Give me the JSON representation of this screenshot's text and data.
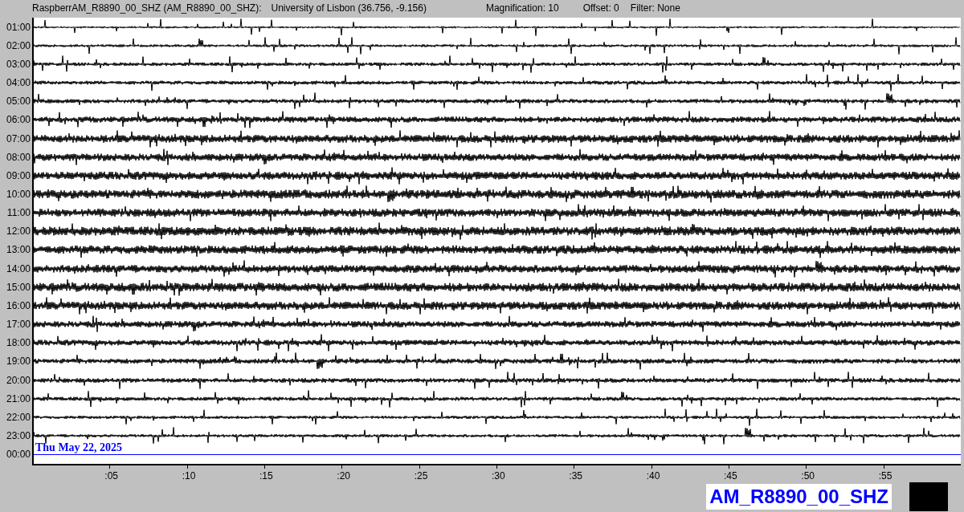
{
  "header": {
    "station": "RaspberrAM_R8890_00_SHZ (AM_R8890_00_SHZ):",
    "location": "University of Lisbon (36.756, -9.156)",
    "magnification": "Magnification: 10",
    "offset": "Offset: 0",
    "filter": "Filter: None"
  },
  "rows": [
    {
      "label": "01:00",
      "kind": "trace"
    },
    {
      "label": "02:00",
      "kind": "trace"
    },
    {
      "label": "03:00",
      "kind": "trace"
    },
    {
      "label": "04:00",
      "kind": "trace"
    },
    {
      "label": "05:00",
      "kind": "trace"
    },
    {
      "label": "06:00",
      "kind": "trace"
    },
    {
      "label": "07:00",
      "kind": "trace"
    },
    {
      "label": "08:00",
      "kind": "trace"
    },
    {
      "label": "09:00",
      "kind": "trace"
    },
    {
      "label": "10:00",
      "kind": "trace"
    },
    {
      "label": "11:00",
      "kind": "trace"
    },
    {
      "label": "12:00",
      "kind": "trace"
    },
    {
      "label": "13:00",
      "kind": "trace"
    },
    {
      "label": "14:00",
      "kind": "trace"
    },
    {
      "label": "15:00",
      "kind": "trace"
    },
    {
      "label": "16:00",
      "kind": "trace"
    },
    {
      "label": "17:00",
      "kind": "trace"
    },
    {
      "label": "18:00",
      "kind": "trace"
    },
    {
      "label": "19:00",
      "kind": "trace"
    },
    {
      "label": "20:00",
      "kind": "trace"
    },
    {
      "label": "21:00",
      "kind": "trace"
    },
    {
      "label": "22:00",
      "kind": "trace"
    },
    {
      "label": "23:00",
      "kind": "trace"
    },
    {
      "label": "00:00",
      "kind": "current",
      "date": "Thu May 22, 2025"
    }
  ],
  "time_axis": [
    ":05",
    ":10",
    ":15",
    ":20",
    ":25",
    ":30",
    ":35",
    ":40",
    ":45",
    ":50",
    ":55"
  ],
  "channel_badge": "AM_R8890_00_SHZ"
}
